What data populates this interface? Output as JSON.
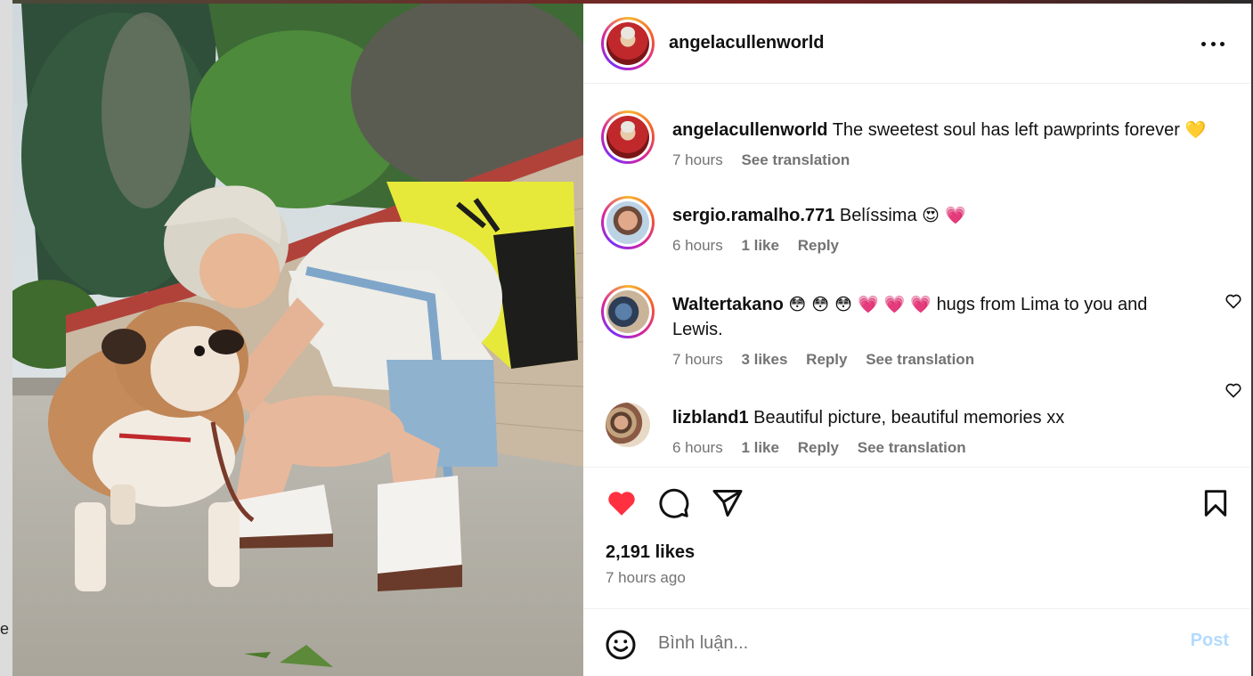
{
  "backdrop": {
    "cut_text": "e"
  },
  "post": {
    "author": "angelacullenworld",
    "caption": {
      "username": "angelacullenworld",
      "text": "The sweetest soul has left pawprints forever",
      "emoji": "💛",
      "time": "7 hours",
      "see_translation": "See translation"
    },
    "comments": [
      {
        "username": "sergio.ramalho.771",
        "text": "Belíssima",
        "emoji": "😍 💗",
        "time": "6 hours",
        "likes": "1 like",
        "reply": "Reply",
        "see_translation": ""
      },
      {
        "username": "Waltertakano",
        "text": "hugs from Lima to you and Lewis.",
        "emoji": "😳 😳 😳 💗 💗 💗",
        "time": "7 hours",
        "likes": "3 likes",
        "reply": "Reply",
        "see_translation": "See translation"
      },
      {
        "username": "lizbland1",
        "text": "Beautiful picture, beautiful memories xx",
        "emoji": "",
        "time": "6 hours",
        "likes": "1 like",
        "reply": "Reply",
        "see_translation": "See translation"
      }
    ],
    "likes_count": "2,191 likes",
    "posted_ago": "7 hours ago",
    "liked": true
  },
  "composer": {
    "placeholder": "Bình luận...",
    "post_label": "Post"
  },
  "icons": {
    "more": "more-horizontal-icon",
    "like": "heart-filled-icon",
    "comment": "comment-bubble-icon",
    "share": "paper-plane-icon",
    "save": "bookmark-icon",
    "emoji": "smiley-face-icon",
    "comment_like": "heart-outline-icon"
  },
  "colors": {
    "like_red": "#ff3040",
    "muted_text": "#737373",
    "post_button_disabled": "#b3dbff"
  }
}
